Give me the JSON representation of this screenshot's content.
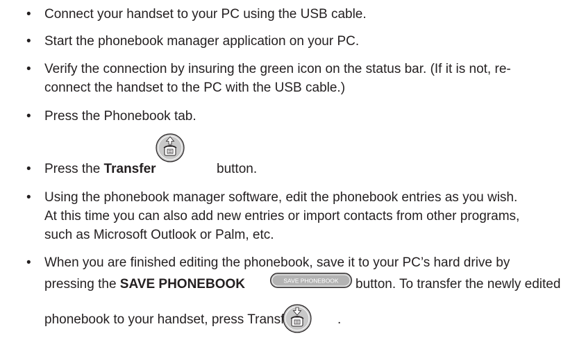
{
  "document": {
    "bullet_glyph": "•",
    "items": [
      {
        "text": "Connect your handset to your PC using the USB cable."
      },
      {
        "text": "Start the phonebook manager application on your PC."
      },
      {
        "line1": "Verify the connection by insuring the green icon on the status bar. (If it is not, re-",
        "line2": "connect the handset to the PC with the USB cable.)"
      },
      {
        "text": "Press the Phonebook tab."
      },
      {
        "before": "Press the ",
        "bold": "Transfer",
        "after": "button."
      },
      {
        "line1": "Using the phonebook manager software, edit the phonebook entries as you wish.",
        "line2": "At this time you can also add new entries or import contacts from other programs,",
        "line3": "such as Microsoft Outlook or Palm, etc."
      },
      {
        "line1": "When you are finished editing the phonebook, save it to your PC’s hard drive by",
        "line2_before": "pressing the ",
        "line2_bold": "SAVE PHONEBOOK",
        "line2_after": "button. To transfer the newly edited",
        "line3_before": "phonebook to your handset, press Transfer",
        "line3_after": "."
      }
    ],
    "save_button_label": "SAVE PHONEBOOK",
    "icons": {
      "upload": "phone-upload-icon",
      "download": "phone-download-icon"
    },
    "colors": {
      "text": "#231f20",
      "icon_fill": "#c8c8c8",
      "button_fill": "#b3b3b3"
    }
  }
}
